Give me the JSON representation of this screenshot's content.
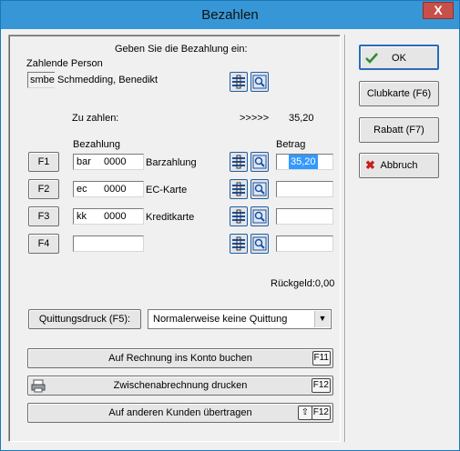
{
  "window": {
    "title": "Bezahlen",
    "close_symbol": "X"
  },
  "header": {
    "instruction": "Geben Sie die Bezahlung ein:",
    "payer_label": "Zahlende Person",
    "payer_code": "smbe",
    "payer_name": "Schmedding, Benedikt"
  },
  "due": {
    "label": "Zu zahlen:",
    "arrows": ">>>>>",
    "amount": "35,20"
  },
  "payments": {
    "col_payment": "Bezahlung",
    "col_amount": "Betrag",
    "rows": [
      {
        "fkey": "F1",
        "code": "bar",
        "number": "0000",
        "type": "Barzahlung",
        "amount": "35,20"
      },
      {
        "fkey": "F2",
        "code": "ec",
        "number": "0000",
        "type": "EC-Karte",
        "amount": ""
      },
      {
        "fkey": "F3",
        "code": "kk",
        "number": "0000",
        "type": "Kreditkarte",
        "amount": ""
      },
      {
        "fkey": "F4",
        "code": "",
        "number": "",
        "type": "",
        "amount": ""
      }
    ]
  },
  "change": {
    "label": "Rückgeld:0,00"
  },
  "receipt": {
    "button_label": "Quittungsdruck (F5):",
    "option": "Normalerweise keine Quittung"
  },
  "actions": {
    "account": {
      "label": "Auf Rechnung ins Konto buchen",
      "key": "F11"
    },
    "interim": {
      "label": "Zwischenabrechnung drucken",
      "key": "F12"
    },
    "transfer": {
      "label": "Auf anderen Kunden übertragen",
      "key": "F12",
      "modifier": "⇧"
    }
  },
  "right": {
    "ok": "OK",
    "club": "Clubkarte (F6)",
    "discount": "Rabatt (F7)",
    "cancel": "Abbruch"
  },
  "colors": {
    "accent_title": "#3797d6",
    "selection": "#3399ff",
    "close": "#c7504a"
  }
}
